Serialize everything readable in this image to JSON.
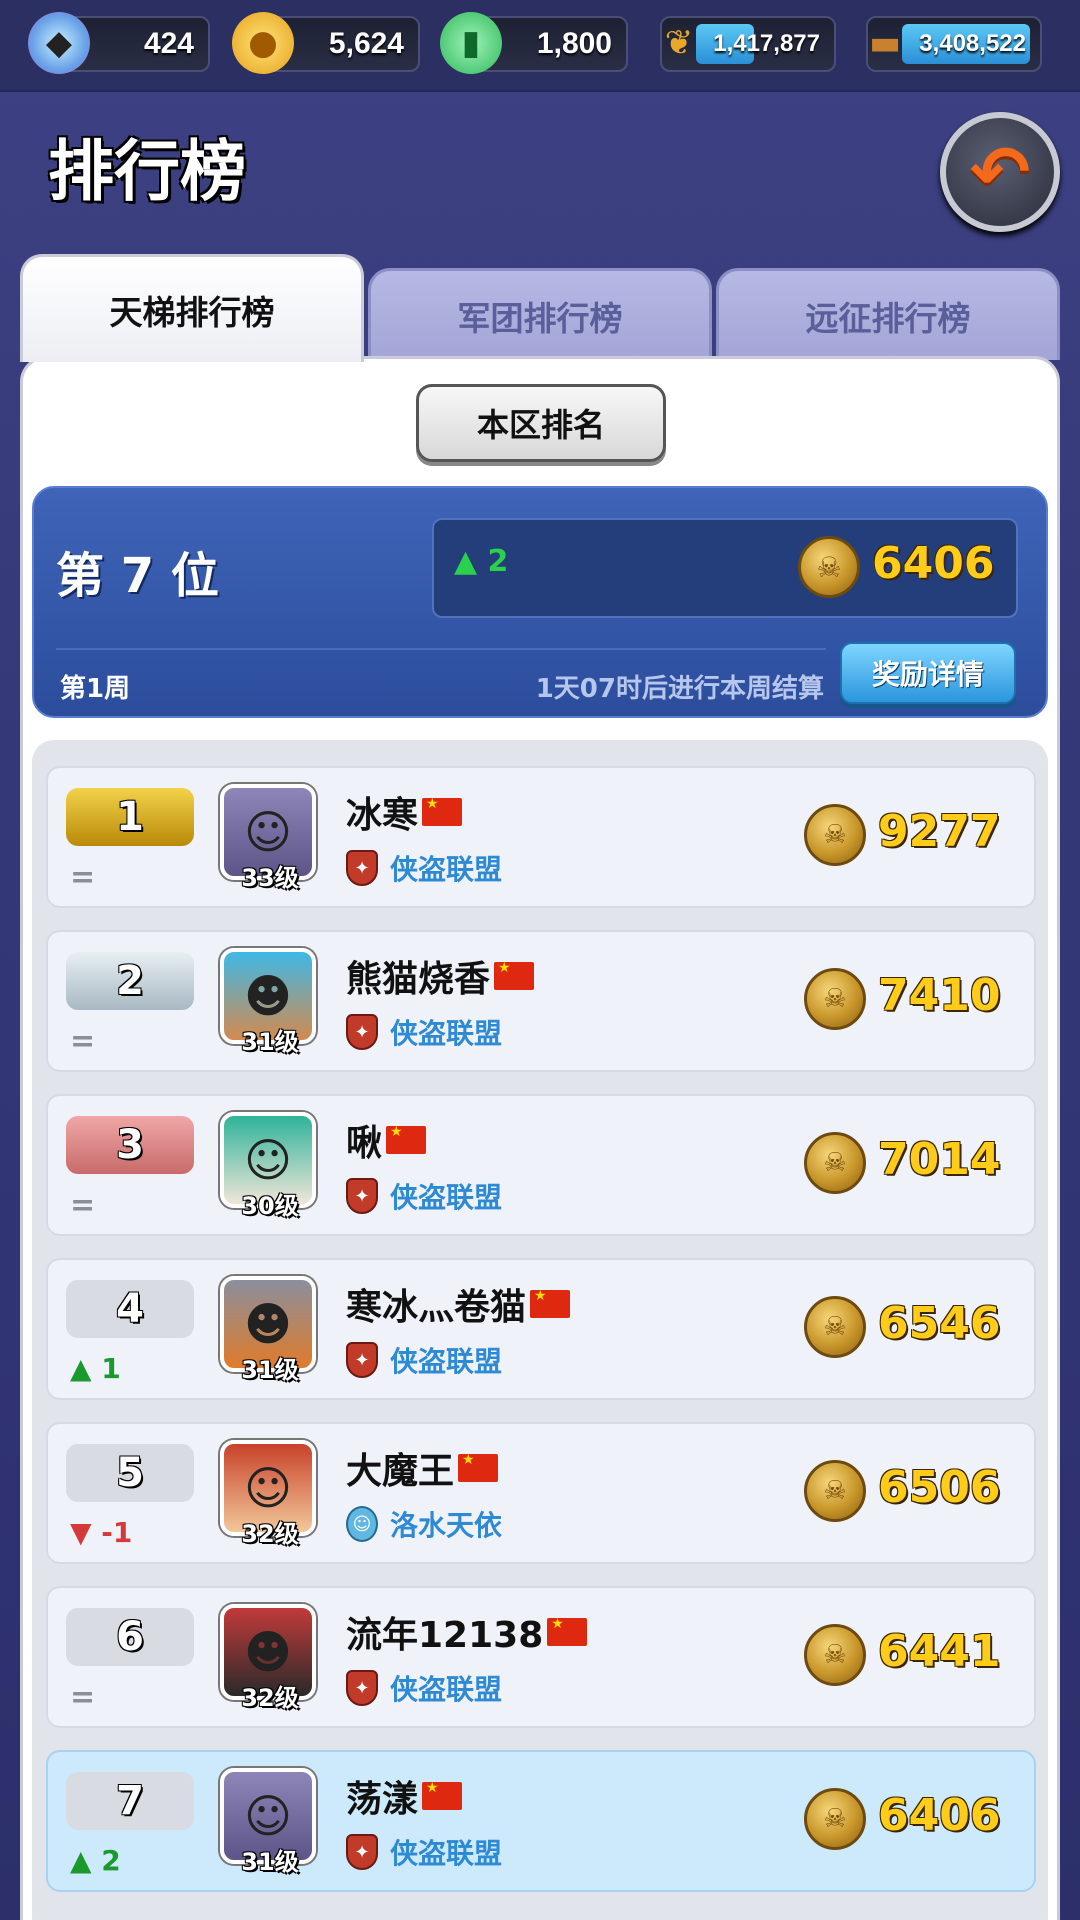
{
  "resources": [
    {
      "name": "gem",
      "icon": "gem-icon",
      "value": "424"
    },
    {
      "name": "gold",
      "icon": "gold-coin-icon",
      "value": "5,624"
    },
    {
      "name": "jade",
      "icon": "jade-token-icon",
      "value": "1,800"
    },
    {
      "name": "wheat",
      "icon": "wheat-icon",
      "value": "1,417,877"
    },
    {
      "name": "wood",
      "icon": "wood-log-icon",
      "value": "3,408,522"
    }
  ],
  "page": {
    "title": "排行榜",
    "back_icon": "back-arrow-icon"
  },
  "tabs": [
    {
      "label": "天梯排行榜",
      "active": true
    },
    {
      "label": "军团排行榜",
      "active": false
    },
    {
      "label": "远征排行榜",
      "active": false
    }
  ],
  "scope_button": "本区排名",
  "my_rank": {
    "rank_text": "第 7 位",
    "change": "▲ 2",
    "score": "6406",
    "week": "第1周",
    "settle_text": "1天07时后进行本周结算",
    "reward_button": "奖励详情"
  },
  "rows": [
    {
      "rank": "1",
      "change": "=",
      "change_type": "same",
      "level": "33级",
      "name": "冰寒",
      "guild": "侠盗联盟",
      "score": "9277"
    },
    {
      "rank": "2",
      "change": "=",
      "change_type": "same",
      "level": "31级",
      "name": "熊猫烧香",
      "guild": "侠盗联盟",
      "score": "7410"
    },
    {
      "rank": "3",
      "change": "=",
      "change_type": "same",
      "level": "30级",
      "name": "啾",
      "guild": "侠盗联盟",
      "score": "7014"
    },
    {
      "rank": "4",
      "change": "▲ 1",
      "change_type": "up",
      "level": "31级",
      "name": "寒冰灬卷猫",
      "guild": "侠盗联盟",
      "score": "6546"
    },
    {
      "rank": "5",
      "change": "▼ -1",
      "change_type": "down",
      "level": "32级",
      "name": "大魔王",
      "guild": "洛水天依",
      "score": "6506"
    },
    {
      "rank": "6",
      "change": "=",
      "change_type": "same",
      "level": "32级",
      "name": "流年12138",
      "guild": "侠盗联盟",
      "score": "6441"
    },
    {
      "rank": "7",
      "change": "▲ 2",
      "change_type": "up",
      "level": "31级",
      "name": "荡漾",
      "guild": "侠盗联盟",
      "score": "6406"
    }
  ],
  "colors": {
    "accent": "#3f64b8",
    "score": "#ffcc1a",
    "highlight_row": "#cdeafc"
  }
}
